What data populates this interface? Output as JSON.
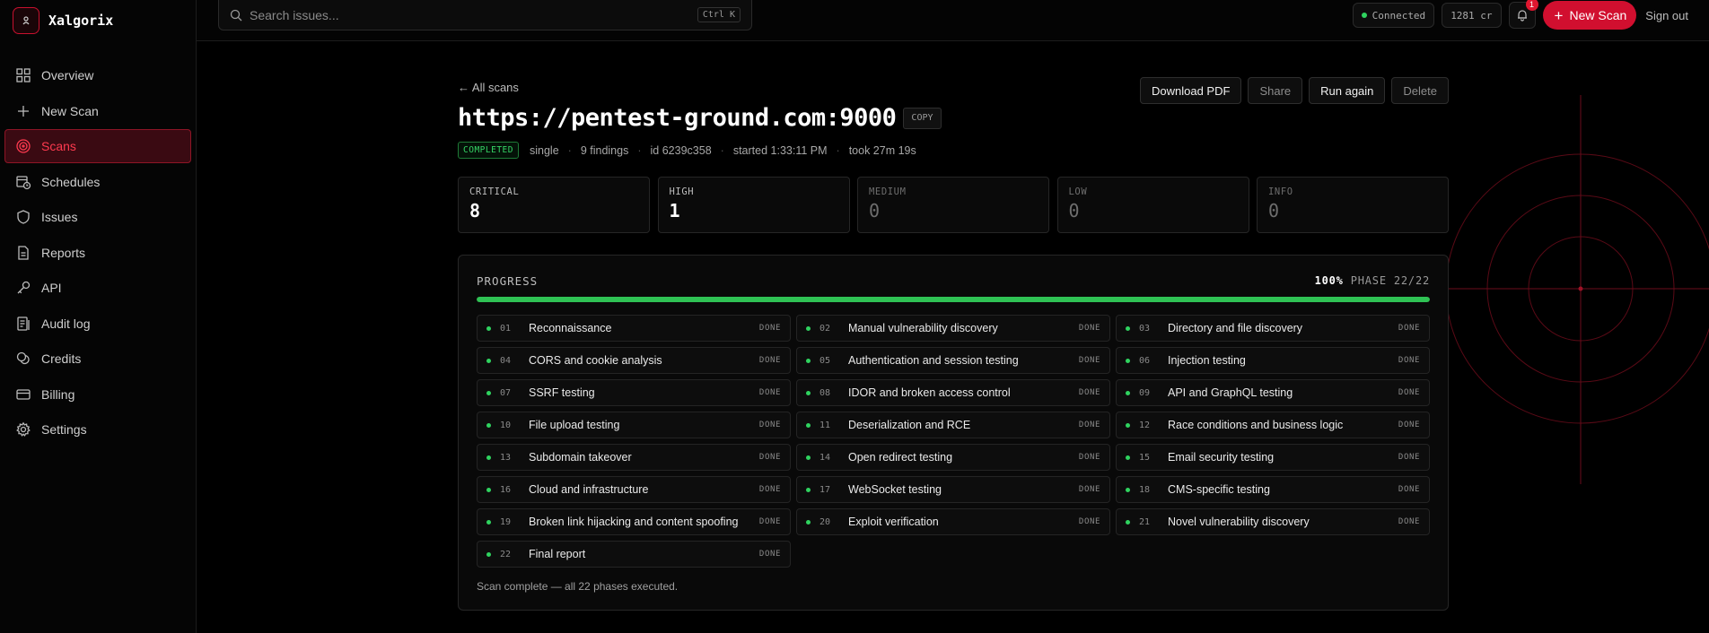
{
  "brand": {
    "name": "Xalgorix"
  },
  "sidebar": {
    "items": [
      {
        "label": "Overview",
        "icon": "grid-icon",
        "active": false
      },
      {
        "label": "New Scan",
        "icon": "plus-icon",
        "active": false
      },
      {
        "label": "Scans",
        "icon": "target-icon",
        "active": true
      },
      {
        "label": "Schedules",
        "icon": "calendar-clock-icon",
        "active": false
      },
      {
        "label": "Issues",
        "icon": "shield-icon",
        "active": false
      },
      {
        "label": "Reports",
        "icon": "document-icon",
        "active": false
      },
      {
        "label": "API",
        "icon": "key-icon",
        "active": false
      },
      {
        "label": "Audit log",
        "icon": "log-icon",
        "active": false
      },
      {
        "label": "Credits",
        "icon": "coins-icon",
        "active": false
      },
      {
        "label": "Billing",
        "icon": "card-icon",
        "active": false
      },
      {
        "label": "Settings",
        "icon": "gear-icon",
        "active": false
      }
    ]
  },
  "topbar": {
    "search_placeholder": "Search issues...",
    "search_shortcut": "Ctrl K",
    "connection_status": "Connected",
    "credits": "1281 cr",
    "notification_count": "1",
    "new_scan_label": "New Scan",
    "sign_out_label": "Sign out"
  },
  "scan": {
    "back_label": "← All scans",
    "target_url": "https://pentest-ground.com:9000",
    "copy_label": "COPY",
    "actions": {
      "download_pdf": "Download PDF",
      "share": "Share",
      "run_again": "Run again",
      "delete": "Delete"
    },
    "status": "COMPLETED",
    "mode": "single",
    "findings": "9 findings",
    "id_label": "id",
    "id_value": "6239c358",
    "started": "started 1:33:11 PM",
    "duration": "took 27m 19s"
  },
  "severity": [
    {
      "label": "CRITICAL",
      "count": "8"
    },
    {
      "label": "HIGH",
      "count": "1"
    },
    {
      "label": "MEDIUM",
      "count": "0"
    },
    {
      "label": "LOW",
      "count": "0"
    },
    {
      "label": "INFO",
      "count": "0"
    }
  ],
  "progress": {
    "title": "PROGRESS",
    "percent_label": "100%",
    "percent": 100,
    "phase_label": "PHASE 22/22",
    "phases": [
      {
        "num": "01",
        "name": "Reconnaissance",
        "status": "DONE"
      },
      {
        "num": "02",
        "name": "Manual vulnerability discovery",
        "status": "DONE"
      },
      {
        "num": "03",
        "name": "Directory and file discovery",
        "status": "DONE"
      },
      {
        "num": "04",
        "name": "CORS and cookie analysis",
        "status": "DONE"
      },
      {
        "num": "05",
        "name": "Authentication and session testing",
        "status": "DONE"
      },
      {
        "num": "06",
        "name": "Injection testing",
        "status": "DONE"
      },
      {
        "num": "07",
        "name": "SSRF testing",
        "status": "DONE"
      },
      {
        "num": "08",
        "name": "IDOR and broken access control",
        "status": "DONE"
      },
      {
        "num": "09",
        "name": "API and GraphQL testing",
        "status": "DONE"
      },
      {
        "num": "10",
        "name": "File upload testing",
        "status": "DONE"
      },
      {
        "num": "11",
        "name": "Deserialization and RCE",
        "status": "DONE"
      },
      {
        "num": "12",
        "name": "Race conditions and business logic",
        "status": "DONE"
      },
      {
        "num": "13",
        "name": "Subdomain takeover",
        "status": "DONE"
      },
      {
        "num": "14",
        "name": "Open redirect testing",
        "status": "DONE"
      },
      {
        "num": "15",
        "name": "Email security testing",
        "status": "DONE"
      },
      {
        "num": "16",
        "name": "Cloud and infrastructure",
        "status": "DONE"
      },
      {
        "num": "17",
        "name": "WebSocket testing",
        "status": "DONE"
      },
      {
        "num": "18",
        "name": "CMS-specific testing",
        "status": "DONE"
      },
      {
        "num": "19",
        "name": "Broken link hijacking and content spoofing",
        "status": "DONE"
      },
      {
        "num": "20",
        "name": "Exploit verification",
        "status": "DONE"
      },
      {
        "num": "21",
        "name": "Novel vulnerability discovery",
        "status": "DONE"
      },
      {
        "num": "22",
        "name": "Final report",
        "status": "DONE"
      }
    ],
    "complete_message": "Scan complete — all 22 phases executed."
  },
  "colors": {
    "accent": "#d10f2f",
    "success": "#2fd35f",
    "background": "#000000"
  }
}
